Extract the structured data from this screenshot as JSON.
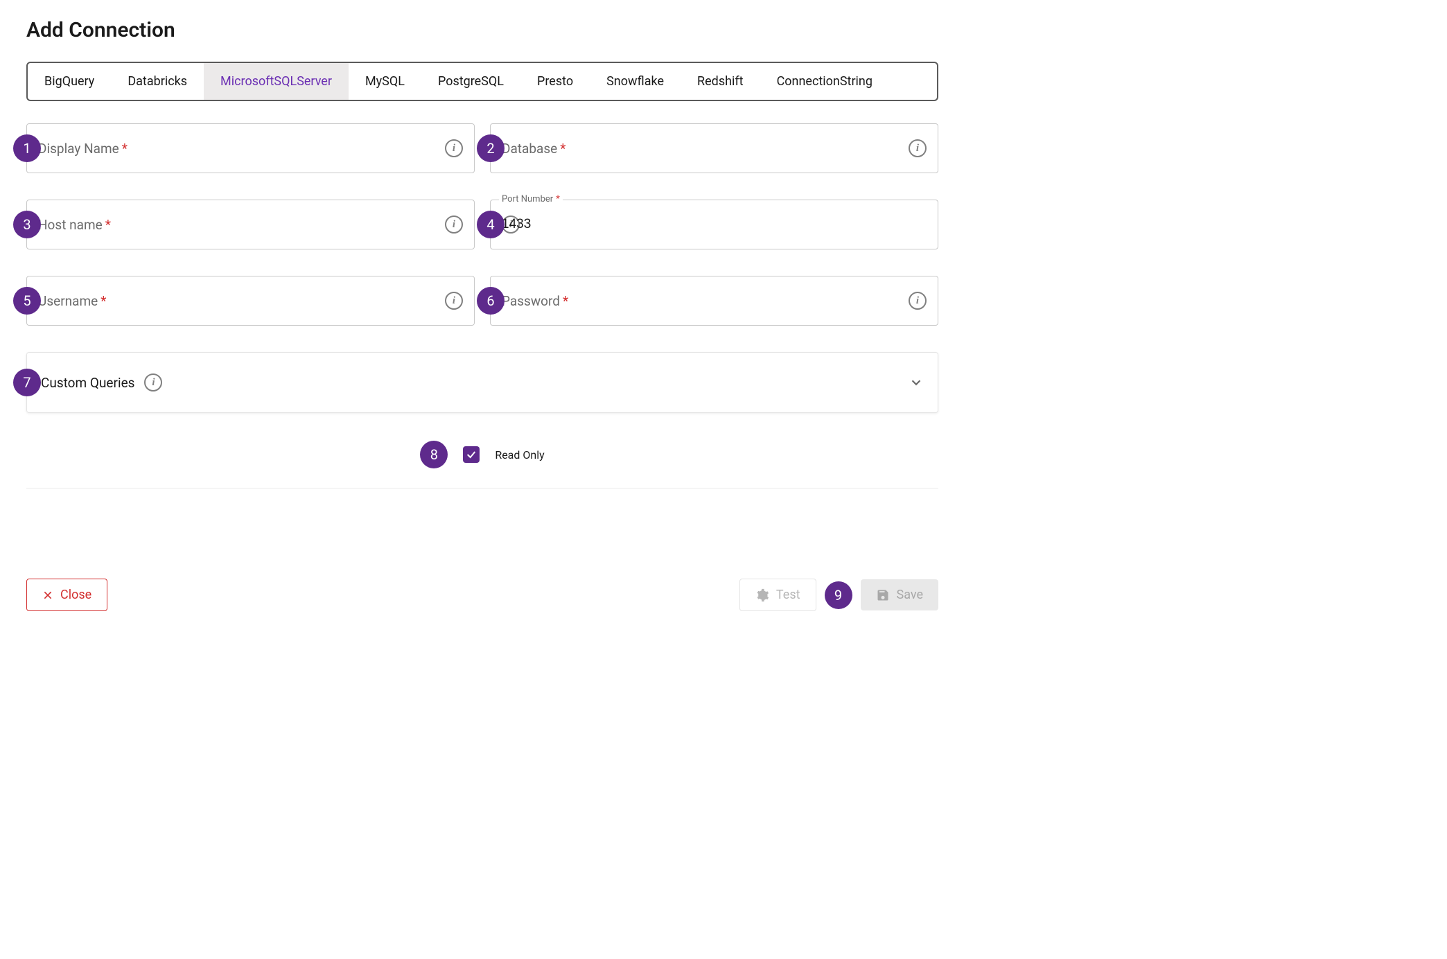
{
  "title": "Add Connection",
  "tabs": [
    {
      "label": "BigQuery",
      "active": false
    },
    {
      "label": "Databricks",
      "active": false
    },
    {
      "label": "MicrosoftSQLServer",
      "active": true
    },
    {
      "label": "MySQL",
      "active": false
    },
    {
      "label": "PostgreSQL",
      "active": false
    },
    {
      "label": "Presto",
      "active": false
    },
    {
      "label": "Snowflake",
      "active": false
    },
    {
      "label": "Redshift",
      "active": false
    },
    {
      "label": "ConnectionString",
      "active": false
    }
  ],
  "fields": {
    "displayName": {
      "label": "Display Name",
      "value": "",
      "required": true,
      "badge": "1"
    },
    "database": {
      "label": "Database",
      "value": "",
      "required": true,
      "badge": "2"
    },
    "hostName": {
      "label": "Host name",
      "value": "",
      "required": true,
      "badge": "3"
    },
    "portNumber": {
      "label": "Port Number",
      "value": "1433",
      "required": true,
      "badge": "4"
    },
    "username": {
      "label": "Username",
      "value": "",
      "required": true,
      "badge": "5"
    },
    "password": {
      "label": "Password",
      "value": "",
      "required": true,
      "badge": "6"
    }
  },
  "accordion": {
    "title": "Custom Queries",
    "badge": "7"
  },
  "readOnly": {
    "label": "Read Only",
    "checked": true,
    "badge": "8"
  },
  "footer": {
    "close": "Close",
    "test": "Test",
    "save": "Save",
    "saveBadge": "9"
  }
}
